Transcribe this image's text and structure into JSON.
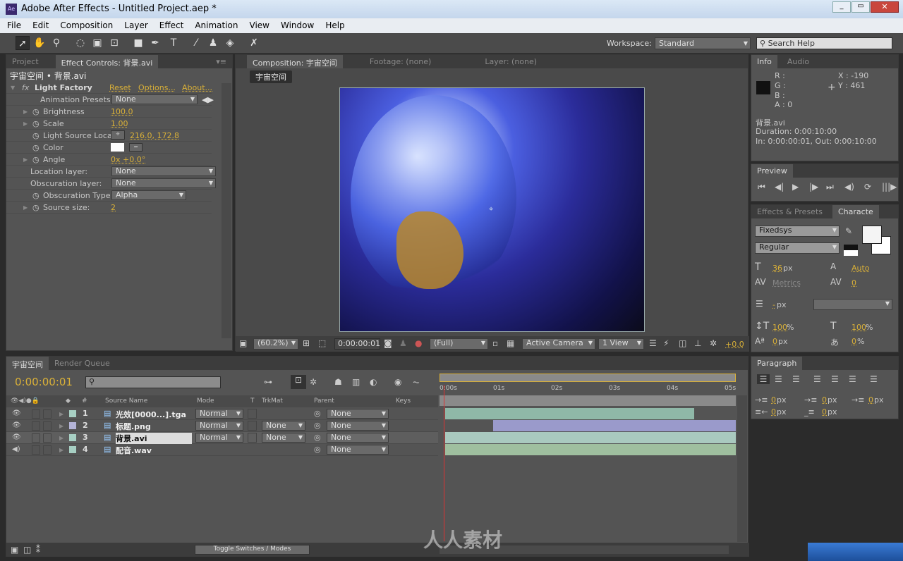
{
  "window": {
    "title": "Adobe After Effects - Untitled Project.aep *",
    "app_icon": "Ae"
  },
  "menu": [
    "File",
    "Edit",
    "Composition",
    "Layer",
    "Effect",
    "Animation",
    "View",
    "Window",
    "Help"
  ],
  "toolbar": {
    "workspace_label": "Workspace:",
    "workspace_value": "Standard",
    "search_placeholder": "Search Help"
  },
  "left_panel": {
    "tabs": [
      "Project",
      "Effect Controls: 背景.avi"
    ],
    "breadcrumb": "宇宙空间 • 背景.avi",
    "effect": {
      "name": "Light Factory",
      "reset": "Reset",
      "options": "Options...",
      "about": "About...",
      "animation_presets_label": "Animation Presets:",
      "animation_presets_value": "None",
      "params": [
        {
          "label": "Brightness",
          "value": "100.0"
        },
        {
          "label": "Scale",
          "value": "1.00"
        },
        {
          "label": "Light Source Loca",
          "value": "216.0, 172.8"
        },
        {
          "label": "Color",
          "value": ""
        },
        {
          "label": "Angle",
          "value": "0x +0.0°"
        },
        {
          "label": "Location layer:",
          "value": "None"
        },
        {
          "label": "Obscuration layer:",
          "value": "None"
        },
        {
          "label": "Obscuration Type",
          "value": "Alpha"
        },
        {
          "label": "Source size:",
          "value": "2"
        }
      ]
    }
  },
  "comp_panel": {
    "tabs": [
      "Composition: 宇宙空间",
      "Footage: (none)",
      "Layer: (none)"
    ],
    "comp_name": "宇宙空间",
    "footer": {
      "zoom": "(60.2%)",
      "timecode": "0:00:00:01",
      "resolution": "(Full)",
      "camera": "Active Camera",
      "views": "1 View",
      "exposure": "+0.0"
    }
  },
  "info": {
    "tabs": [
      "Info",
      "Audio"
    ],
    "R": "R :",
    "G": "G :",
    "B": "B :",
    "A": "A : 0",
    "X": "X : -190",
    "Y": "Y : 461",
    "file": "背景.avi",
    "duration": "Duration: 0:00:10:00",
    "inout": "In: 0:00:00:01, Out: 0:00:10:00"
  },
  "preview": {
    "tab": "Preview"
  },
  "character": {
    "tabs": [
      "Effects & Presets",
      "Characte"
    ],
    "font": "Fixedsys",
    "style": "Regular",
    "size": "36",
    "size_unit": "px",
    "leading": "Auto",
    "kerning": "Metrics",
    "tracking": "0",
    "line": "-",
    "line_unit": "px",
    "vscale": "100",
    "hscale": "100",
    "pct": "%",
    "baseline": "0",
    "tsume": "0"
  },
  "paragraph": {
    "tab": "Paragraph",
    "values": [
      "0",
      "0",
      "0",
      "0",
      "0"
    ],
    "unit": "px"
  },
  "timeline": {
    "tabs": [
      "宇宙空间",
      "Render Queue"
    ],
    "timecode": "0:00:00:01",
    "columns": [
      "#",
      "Source Name",
      "Mode",
      "T",
      "TrkMat",
      "Parent",
      "Keys"
    ],
    "ruler": [
      "0:00s",
      "01s",
      "02s",
      "03s",
      "04s",
      "05s"
    ],
    "layers": [
      {
        "num": "1",
        "name": "光效[0000...].tga",
        "mode": "Normal",
        "trkmat": "",
        "parent": "None",
        "color": "#a7cfc3",
        "bar": "#8fb8a8"
      },
      {
        "num": "2",
        "name": "标题.png",
        "mode": "Normal",
        "trkmat": "None",
        "parent": "None",
        "color": "#b4b4d8",
        "bar": "#9a9acb"
      },
      {
        "num": "3",
        "name": "背景.avi",
        "mode": "Normal",
        "trkmat": "None",
        "parent": "None",
        "color": "#a7cfc3",
        "bar": "#a9c9bf"
      },
      {
        "num": "4",
        "name": "配音.wav",
        "mode": "",
        "trkmat": "",
        "parent": "None",
        "color": "#a7cfc3",
        "bar": "#9fbf9f"
      }
    ],
    "toggle_label": "Toggle Switches / Modes"
  },
  "watermark": "人人素材"
}
